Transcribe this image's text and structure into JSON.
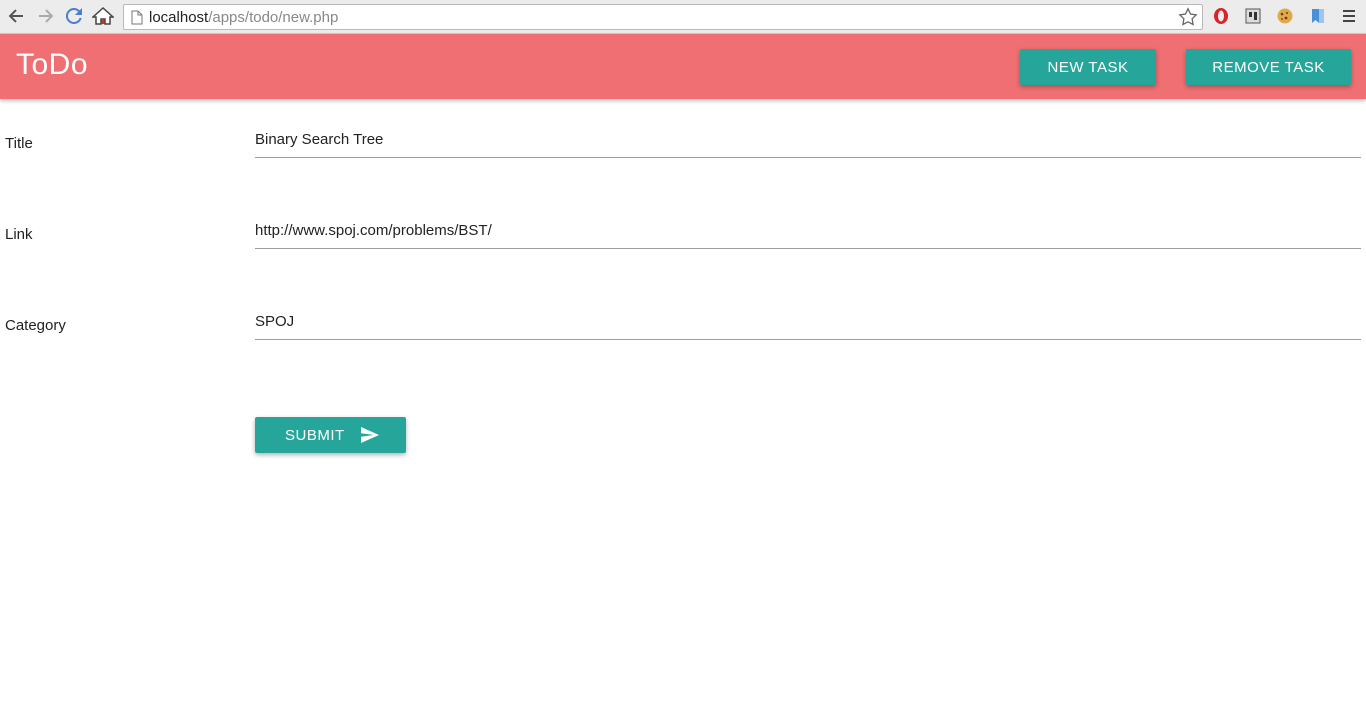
{
  "browser": {
    "url_host": "localhost",
    "url_path": "/apps/todo/new.php",
    "icons": [
      "back-icon",
      "forward-icon",
      "reload-icon",
      "home-icon",
      "page-icon",
      "star-icon",
      "opera-icon",
      "extension-icon",
      "cookie-icon",
      "bookmark-icon",
      "menu-icon"
    ]
  },
  "header": {
    "brand": "ToDo",
    "new_task_label": "NEW TASK",
    "remove_task_label": "REMOVE TASK",
    "bg_color": "#ef6f73",
    "accent_color": "#26a69a"
  },
  "form": {
    "title": {
      "label": "Title",
      "value": "Binary Search Tree"
    },
    "link": {
      "label": "Link",
      "value": "http://www.spoj.com/problems/BST/"
    },
    "category": {
      "label": "Category",
      "value": "SPOJ"
    },
    "submit_label": "SUBMIT"
  }
}
